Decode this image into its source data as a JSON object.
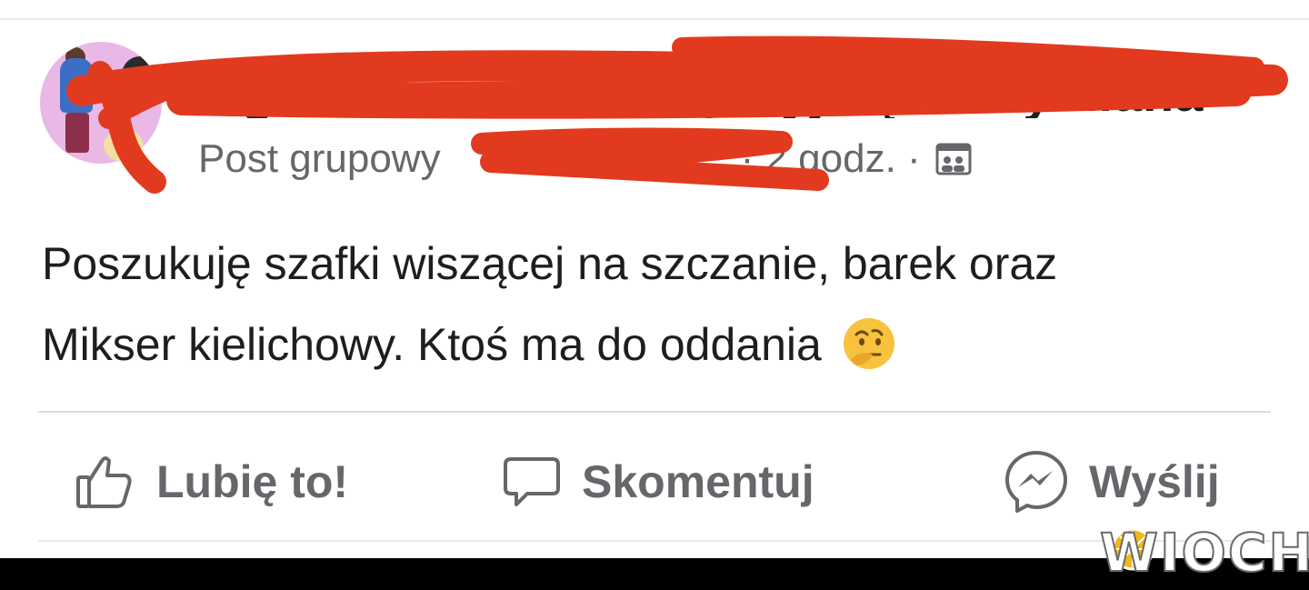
{
  "post": {
    "author_redacted": "Ogłoszenie: oddam przyjmę — wymiana",
    "meta_label": "Post grupowy",
    "time": "· 2 godz. ·",
    "audience_icon": "group-audience-icon",
    "text_line1": "Poszukuję szafki wiszącej na szczanie, barek oraz",
    "text_line2": "Mikser kielichowy. Ktoś ma do oddania",
    "emoji": "thinking-face-emoji"
  },
  "actions": {
    "like_label": "Lubię to!",
    "comment_label": "Skomentuj",
    "share_label": "Wyślij"
  },
  "watermark": {
    "text": "WIOCHA",
    "brand_color": "#c1272d"
  },
  "colors": {
    "redaction": "#e23a1e",
    "meta_text": "#65676b",
    "body_text": "#1c1e21"
  }
}
